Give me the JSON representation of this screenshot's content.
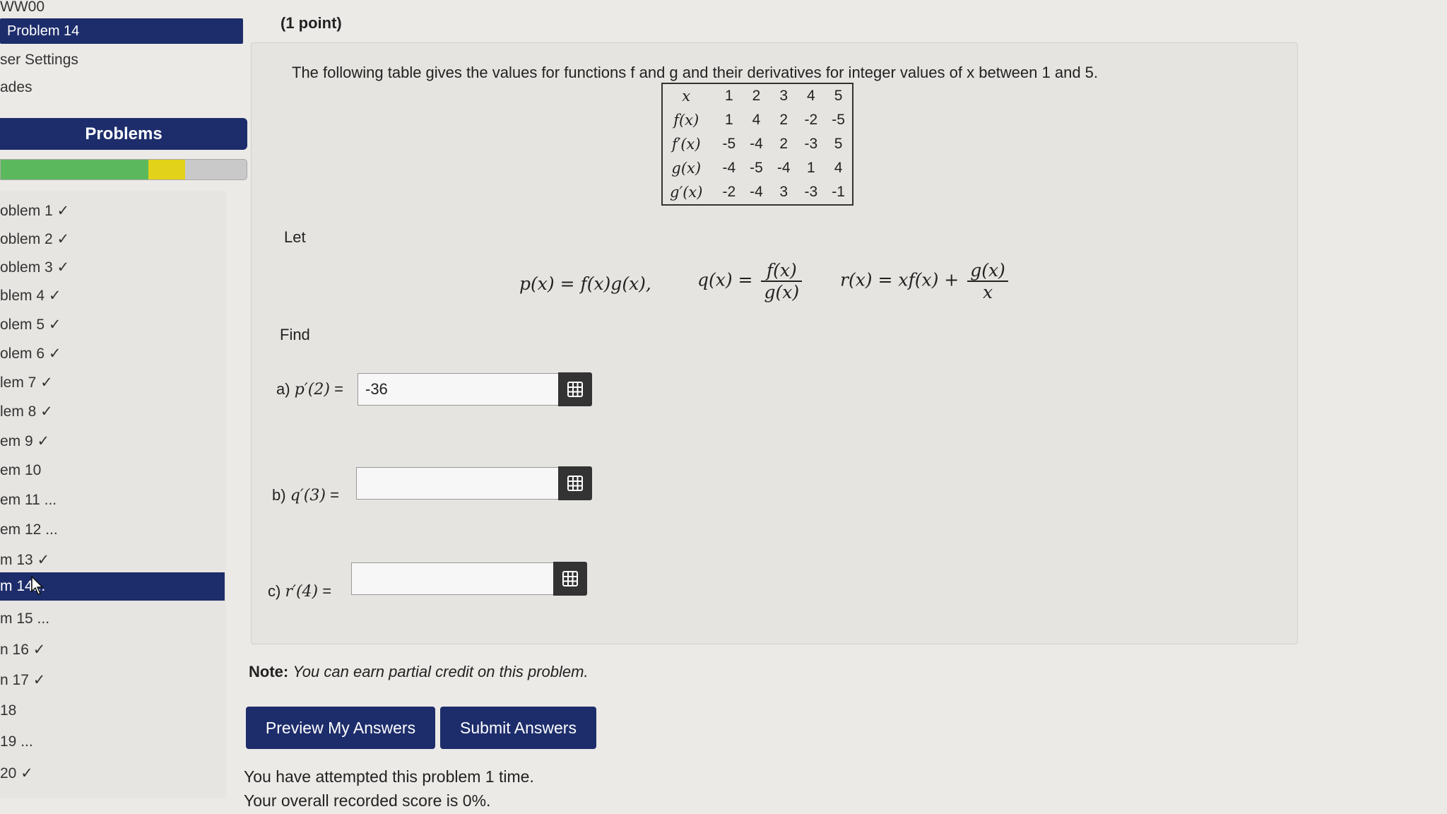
{
  "sidebar": {
    "links": [
      "WW00",
      "ser Settings",
      "ades"
    ],
    "active_link": "Problem 14",
    "problems_header": "Problems",
    "progress": {
      "correct_fraction": 0.6,
      "partial_fraction": 0.15
    },
    "problems": [
      "oblem 1 ✓",
      "oblem 2 ✓",
      "oblem 3 ✓",
      "blem 4 ✓",
      "olem 5 ✓",
      "olem 6 ✓",
      "lem 7 ✓",
      "lem 8 ✓",
      "em 9 ✓",
      "em 10",
      "em 11 ...",
      "em 12 ...",
      "m 13 ✓",
      "m 14...",
      "m 15 ...",
      "n 16 ✓",
      "n 17 ✓",
      "18",
      "19 ...",
      "20 ✓"
    ]
  },
  "main": {
    "points": "(1 point)",
    "intro": "The following table gives the values for functions f and g and their derivatives for integer values of x between 1 and 5.",
    "table": {
      "header": [
        "x",
        "1",
        "2",
        "3",
        "4",
        "5"
      ],
      "rows": [
        [
          "f(x)",
          "1",
          "4",
          "2",
          "-2",
          "-5"
        ],
        [
          "f′(x)",
          "-5",
          "-4",
          "2",
          "-3",
          "5"
        ],
        [
          "g(x)",
          "-4",
          "-5",
          "-4",
          "1",
          "4"
        ],
        [
          "g′(x)",
          "-2",
          "-4",
          "3",
          "-3",
          "-1"
        ]
      ]
    },
    "let_label": "Let",
    "formulas": {
      "p": "p(x) = f(x)g(x),",
      "q_lhs": "q(x) =",
      "q_num": "f(x)",
      "q_den": "g(x)",
      "r_lhs": "r(x) = xf(x) +",
      "r_num": "g(x)",
      "r_den": "x"
    },
    "find_label": "Find",
    "questions": [
      {
        "prefix": "a)",
        "expr": "p′(2)",
        "suffix": "=",
        "value": "-36"
      },
      {
        "prefix": "b)",
        "expr": "q′(3)",
        "suffix": "=",
        "value": ""
      },
      {
        "prefix": "c)",
        "expr": "r′(4)",
        "suffix": "=",
        "value": ""
      }
    ],
    "note_label": "Note:",
    "note_text": "You can earn partial credit on this problem.",
    "buttons": {
      "preview": "Preview My Answers",
      "submit": "Submit Answers"
    },
    "status": [
      "You have attempted this problem 1 time.",
      "Your overall recorded score is 0%."
    ]
  }
}
